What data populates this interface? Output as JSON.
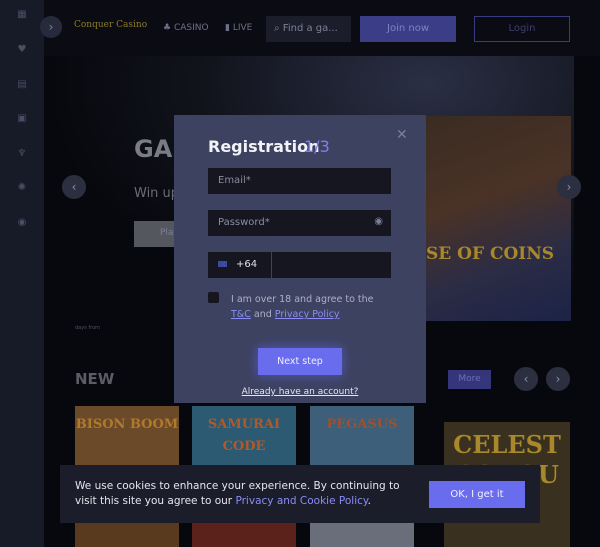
{
  "header": {
    "logo": "Conquer Casino",
    "nav": [
      {
        "label": "CASINO",
        "icon": "clubs-icon"
      },
      {
        "label": "LIVE",
        "icon": "live-cards-icon"
      }
    ],
    "search_placeholder": "Find a ga...",
    "join_label": "Join now",
    "login_label": "Login"
  },
  "sidebar": {
    "icons": [
      "grid-icon",
      "heart-icon",
      "calendar-icon",
      "gift-icon",
      "trophy-icon",
      "settings-icon",
      "chat-icon"
    ]
  },
  "hero": {
    "title": "GAM",
    "subtitle": "Win up",
    "button": "Pla",
    "art_text": "SE OF COINS",
    "small": "days from"
  },
  "section": {
    "title": "NEW",
    "more_label": "More"
  },
  "games": [
    {
      "name": "BISON BOOM",
      "color": "#6b4a2a"
    },
    {
      "name": "SAMURAI CODE",
      "color": "#2c5a72"
    },
    {
      "name": "PEGASUS",
      "color": "#3d5f7a"
    },
    {
      "name": "CELEST CONQU",
      "color": "#3a3020"
    }
  ],
  "modal": {
    "title": "Registration",
    "step": "1/3",
    "email_placeholder": "Email*",
    "password_placeholder": "Password*",
    "country_code": "+64",
    "agree_text": "I am over 18 and agree to the",
    "tc_link": "T&C",
    "and": "and",
    "privacy_link": "Privacy Policy",
    "next_label": "Next step",
    "have_account": "Already have an account?"
  },
  "cookie": {
    "text": "We use cookies to enhance your experience. By continuing to visit this site you agree to our",
    "link": "Privacy and Cookie Policy",
    "ok_label": "OK, I get it"
  },
  "colors": {
    "accent": "#6a6cee",
    "modal_bg": "#3d4260"
  }
}
